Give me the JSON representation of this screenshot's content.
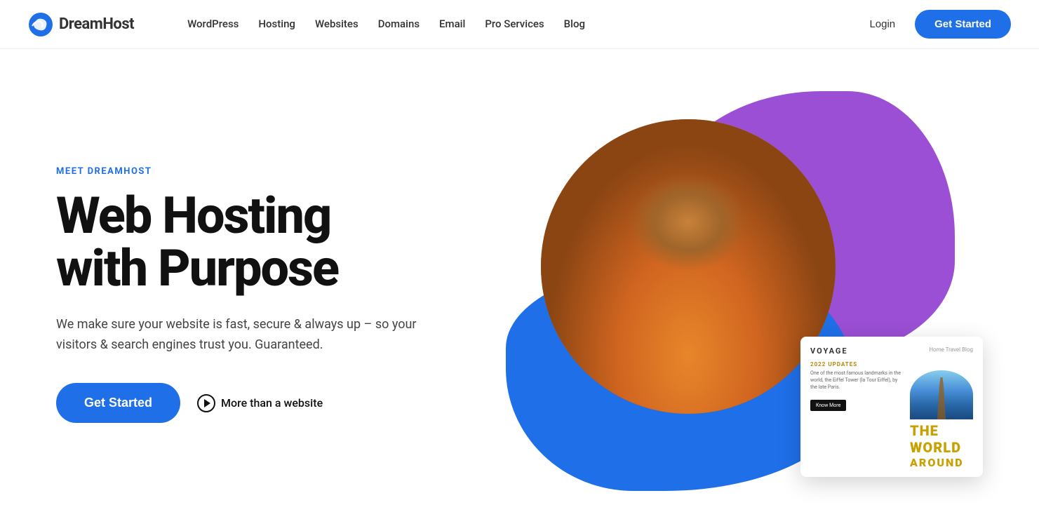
{
  "nav": {
    "logo_text": "DreamHost",
    "links": [
      {
        "label": "WordPress",
        "id": "wordpress"
      },
      {
        "label": "Hosting",
        "id": "hosting"
      },
      {
        "label": "Websites",
        "id": "websites"
      },
      {
        "label": "Domains",
        "id": "domains"
      },
      {
        "label": "Email",
        "id": "email"
      },
      {
        "label": "Pro Services",
        "id": "pro-services"
      },
      {
        "label": "Blog",
        "id": "blog"
      }
    ],
    "login_label": "Login",
    "get_started_label": "Get Started"
  },
  "hero": {
    "meet_label": "MEET DREAMHOST",
    "title_line1": "Web Hosting",
    "title_line2": "with Purpose",
    "subtitle": "We make sure your website is fast, secure & always up – so your visitors & search engines trust you. Guaranteed.",
    "cta_label": "Get Started",
    "more_label": "More than a website"
  },
  "voyage_card": {
    "title": "VOYAGE",
    "nav_items": "Home  Travel  Blog",
    "update_label": "2022 UPDATES",
    "desc": "One of the most famous landmarks in the world, the Eiffel Tower (la Tour Eiffel), by the late Paris.",
    "btn_label": "Know More",
    "world_text": "THE WORLD",
    "around_text": "AROUND"
  },
  "colors": {
    "brand_blue": "#1f6fe8",
    "brand_purple": "#9b4fd4",
    "accent_gold": "#c8a000"
  }
}
